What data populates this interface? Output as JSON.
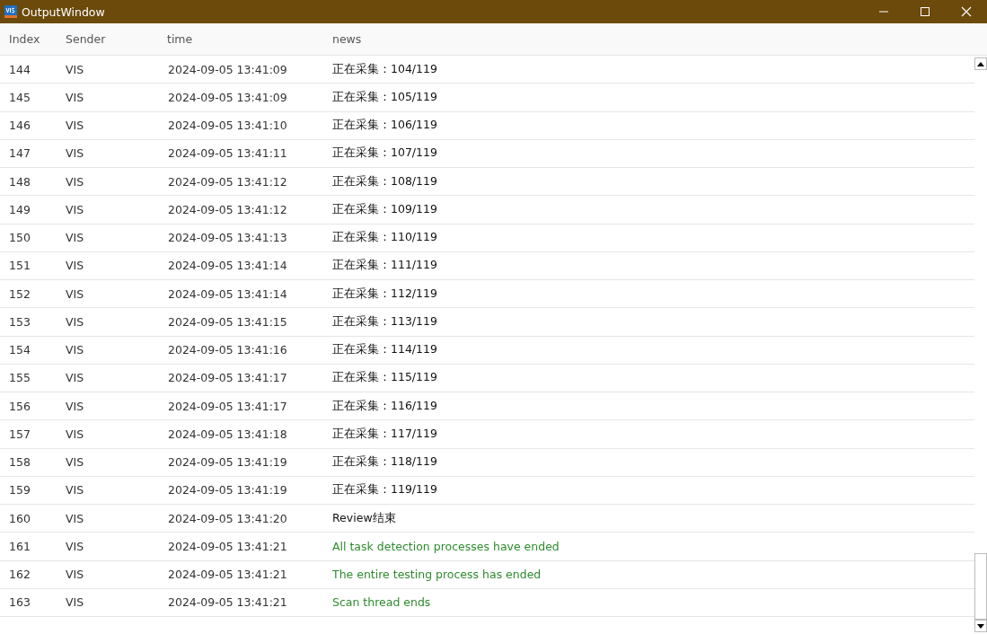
{
  "window": {
    "title": "OutputWindow"
  },
  "table": {
    "columns": [
      "Index",
      "Sender",
      "time",
      "news"
    ],
    "rows": [
      {
        "index": "144",
        "sender": "VIS",
        "time": "2024-09-05 13:41:09",
        "news": "正在采集：104/119",
        "kind": "info"
      },
      {
        "index": "145",
        "sender": "VIS",
        "time": "2024-09-05 13:41:09",
        "news": "正在采集：105/119",
        "kind": "info"
      },
      {
        "index": "146",
        "sender": "VIS",
        "time": "2024-09-05 13:41:10",
        "news": "正在采集：106/119",
        "kind": "info"
      },
      {
        "index": "147",
        "sender": "VIS",
        "time": "2024-09-05 13:41:11",
        "news": "正在采集：107/119",
        "kind": "info"
      },
      {
        "index": "148",
        "sender": "VIS",
        "time": "2024-09-05 13:41:12",
        "news": "正在采集：108/119",
        "kind": "info"
      },
      {
        "index": "149",
        "sender": "VIS",
        "time": "2024-09-05 13:41:12",
        "news": "正在采集：109/119",
        "kind": "info"
      },
      {
        "index": "150",
        "sender": "VIS",
        "time": "2024-09-05 13:41:13",
        "news": "正在采集：110/119",
        "kind": "info"
      },
      {
        "index": "151",
        "sender": "VIS",
        "time": "2024-09-05 13:41:14",
        "news": "正在采集：111/119",
        "kind": "info"
      },
      {
        "index": "152",
        "sender": "VIS",
        "time": "2024-09-05 13:41:14",
        "news": "正在采集：112/119",
        "kind": "info"
      },
      {
        "index": "153",
        "sender": "VIS",
        "time": "2024-09-05 13:41:15",
        "news": "正在采集：113/119",
        "kind": "info"
      },
      {
        "index": "154",
        "sender": "VIS",
        "time": "2024-09-05 13:41:16",
        "news": "正在采集：114/119",
        "kind": "info"
      },
      {
        "index": "155",
        "sender": "VIS",
        "time": "2024-09-05 13:41:17",
        "news": "正在采集：115/119",
        "kind": "info"
      },
      {
        "index": "156",
        "sender": "VIS",
        "time": "2024-09-05 13:41:17",
        "news": "正在采集：116/119",
        "kind": "info"
      },
      {
        "index": "157",
        "sender": "VIS",
        "time": "2024-09-05 13:41:18",
        "news": "正在采集：117/119",
        "kind": "info"
      },
      {
        "index": "158",
        "sender": "VIS",
        "time": "2024-09-05 13:41:19",
        "news": "正在采集：118/119",
        "kind": "info"
      },
      {
        "index": "159",
        "sender": "VIS",
        "time": "2024-09-05 13:41:19",
        "news": "正在采集：119/119",
        "kind": "info"
      },
      {
        "index": "160",
        "sender": "VIS",
        "time": "2024-09-05 13:41:20",
        "news": "Review结束",
        "kind": "info"
      },
      {
        "index": "161",
        "sender": "VIS",
        "time": "2024-09-05 13:41:21",
        "news": "All task detection processes have ended",
        "kind": "success"
      },
      {
        "index": "162",
        "sender": "VIS",
        "time": "2024-09-05 13:41:21",
        "news": "The entire testing process has ended",
        "kind": "success"
      },
      {
        "index": "163",
        "sender": "VIS",
        "time": "2024-09-05 13:41:21",
        "news": "Scan thread ends",
        "kind": "success"
      }
    ]
  }
}
